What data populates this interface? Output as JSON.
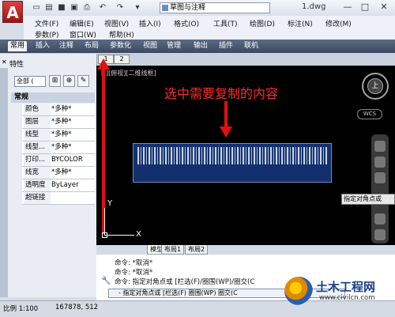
{
  "app": {
    "logo_letter": "A",
    "workspace": "草图与注释",
    "document_title": "1.dwg"
  },
  "window_buttons": [
    "—",
    "□",
    "✕"
  ],
  "menubar": {
    "row1": [
      "文件(F)",
      "编辑(E)",
      "视图(V)",
      "插入(I)",
      "格式(O)",
      "工具(T)",
      "绘图(D)",
      "标注(N)",
      "修改(M)"
    ],
    "row2": [
      "参数(P)",
      "窗口(W)",
      "帮助(H)"
    ]
  },
  "ribbon_tabs": [
    "常用",
    "插入",
    "注释",
    "布局",
    "参数化",
    "视图",
    "管理",
    "输出",
    "插件",
    "联机"
  ],
  "palette": {
    "title": "特性",
    "selection": "全部 (",
    "category": "常规",
    "rows": [
      {
        "name": "颜色",
        "value": "*多种*"
      },
      {
        "name": "图层",
        "value": "*多种*"
      },
      {
        "name": "线型",
        "value": "*多种*"
      },
      {
        "name": "线型...",
        "value": "*多种*"
      },
      {
        "name": "打印...",
        "value": "BYCOLOR"
      },
      {
        "name": "线宽",
        "value": "*多种*"
      },
      {
        "name": "透明度",
        "value": "ByLayer"
      },
      {
        "name": "超链接",
        "value": ""
      }
    ]
  },
  "canvas": {
    "viewport_label": "[-][俯视][二维线框]",
    "annotation": "选中需要复制的内容",
    "compass_label": "上",
    "wcs_label": "WCS",
    "tooltip": "指定对角点或",
    "ucs_x": "X",
    "ucs_y": "Y",
    "layout_tabs_top": [
      "1",
      "2"
    ]
  },
  "model_tabs": [
    "模型",
    "布局1",
    "布局2"
  ],
  "command": {
    "lines": [
      "命令: *取消*",
      "命令: *取消*",
      "命令: 指定对角点或 [栏选(F)/圈围(WP)/圈交(C"
    ],
    "input": "- 指定对角点或 [栏选(F) 圈围(WP) 圈交(C"
  },
  "status": {
    "scale": "比例 1:100",
    "coords": "167878, 512"
  },
  "watermark": {
    "text": "土木工程网",
    "url": "www.civilcn.com"
  }
}
